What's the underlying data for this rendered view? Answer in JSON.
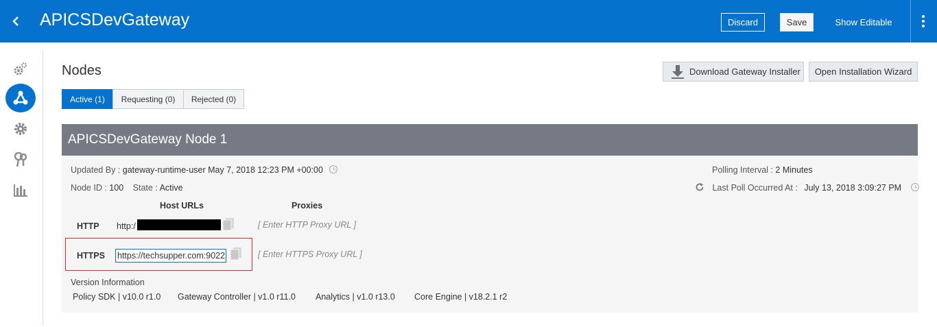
{
  "header": {
    "title": "APICSDevGateway",
    "discard_label": "Discard",
    "save_label": "Save",
    "show_editable_label": "Show Editable",
    "brand_color": "#0572ce"
  },
  "sidebar": {
    "items": [
      {
        "icon": "gears-icon"
      },
      {
        "icon": "nodes-icon",
        "active": true
      },
      {
        "icon": "settings-icon"
      },
      {
        "icon": "keys-icon"
      },
      {
        "icon": "analytics-icon"
      }
    ]
  },
  "main": {
    "title": "Nodes",
    "tabs": [
      {
        "label": "Active (1)",
        "active": true
      },
      {
        "label": "Requesting (0)"
      },
      {
        "label": "Rejected (0)"
      }
    ],
    "download_label": "Download Gateway Installer",
    "wizard_label": "Open Installation Wizard"
  },
  "node": {
    "name": "APICSDevGateway Node 1",
    "updated_by_label": "Updated By :",
    "updated_by_value": "gateway-runtime-user May 7, 2018 12:23 PM +00:00",
    "node_id_label": "Node ID :",
    "node_id_value": "100",
    "state_label": "State :",
    "state_value": "Active",
    "polling_label": "Polling Interval :",
    "polling_value": "2 Minutes",
    "last_poll_label": "Last Poll Occurred At :",
    "last_poll_value": "July 13, 2018 3:09:27 PM",
    "host_urls_header": "Host URLs",
    "proxies_header": "Proxies",
    "http_label": "HTTP",
    "http_url_prefix": "http:/",
    "http_proxy_placeholder": "[ Enter HTTP Proxy URL ]",
    "https_label": "HTTPS",
    "https_url": "https://techsupper.com:9022",
    "https_proxy_placeholder": "[ Enter HTTPS Proxy URL ]",
    "version_title": "Version Information",
    "versions": [
      "Policy SDK | v10.0 r1.0",
      "Gateway Controller | v1.0 r11.0",
      "Analytics | v1.0 r13.0",
      "Core Engine | v18.2.1 r2"
    ]
  }
}
